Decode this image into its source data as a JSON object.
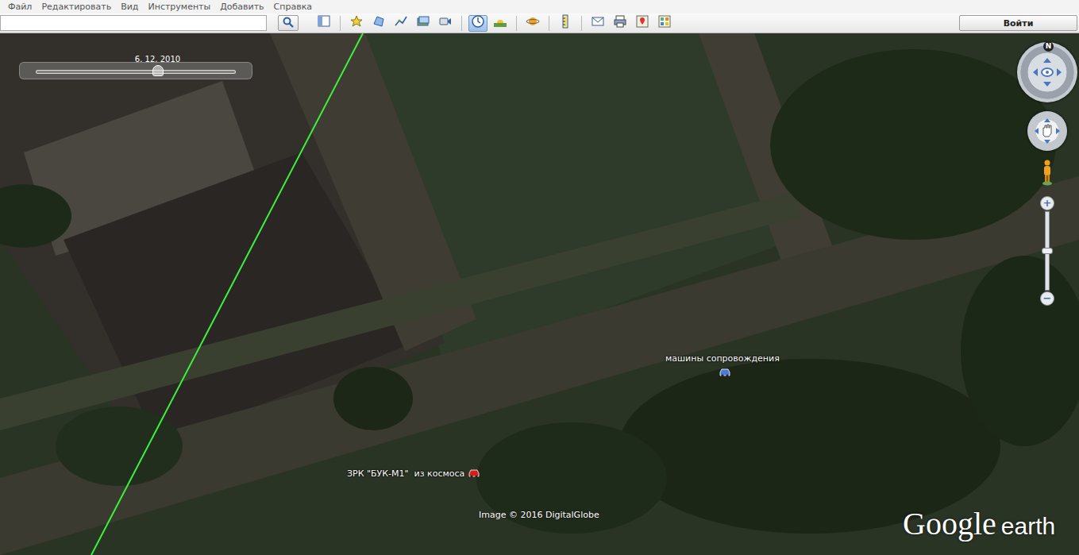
{
  "menu": [
    {
      "label": "Файл"
    },
    {
      "label": "Редактировать"
    },
    {
      "label": "Вид"
    },
    {
      "label": "Инструменты"
    },
    {
      "label": "Добавить"
    },
    {
      "label": "Справка"
    }
  ],
  "toolbar": {
    "search": {
      "value": ""
    },
    "tools": [
      {
        "selected": false
      },
      {
        "selected": false
      },
      {
        "selected": false
      },
      {
        "selected": false
      },
      {
        "selected": false
      },
      {
        "selected": false
      },
      {
        "selected": true
      },
      {
        "selected": false
      },
      {
        "selected": false
      },
      {
        "selected": false
      },
      {
        "selected": false
      },
      {
        "selected": false
      },
      {
        "selected": false
      },
      {
        "selected": false
      }
    ],
    "sign_in": "Войти"
  },
  "time_slider": {
    "date": "6. 12. 2010",
    "level": 0.61
  },
  "compass": {
    "north": "N"
  },
  "zoom": {
    "plus": "+",
    "minus": "−",
    "level": 0.5
  },
  "placemarks": [
    {
      "label": "машины сопровождения",
      "color": "#4d78d6"
    },
    {
      "label": "ЗРК \"БУК-М1\"  из космоса",
      "color": "#d4201c"
    }
  ],
  "attribution": "Image © 2016 DigitalGlobe",
  "logo": {
    "brand": "Google",
    "product": "earth"
  }
}
